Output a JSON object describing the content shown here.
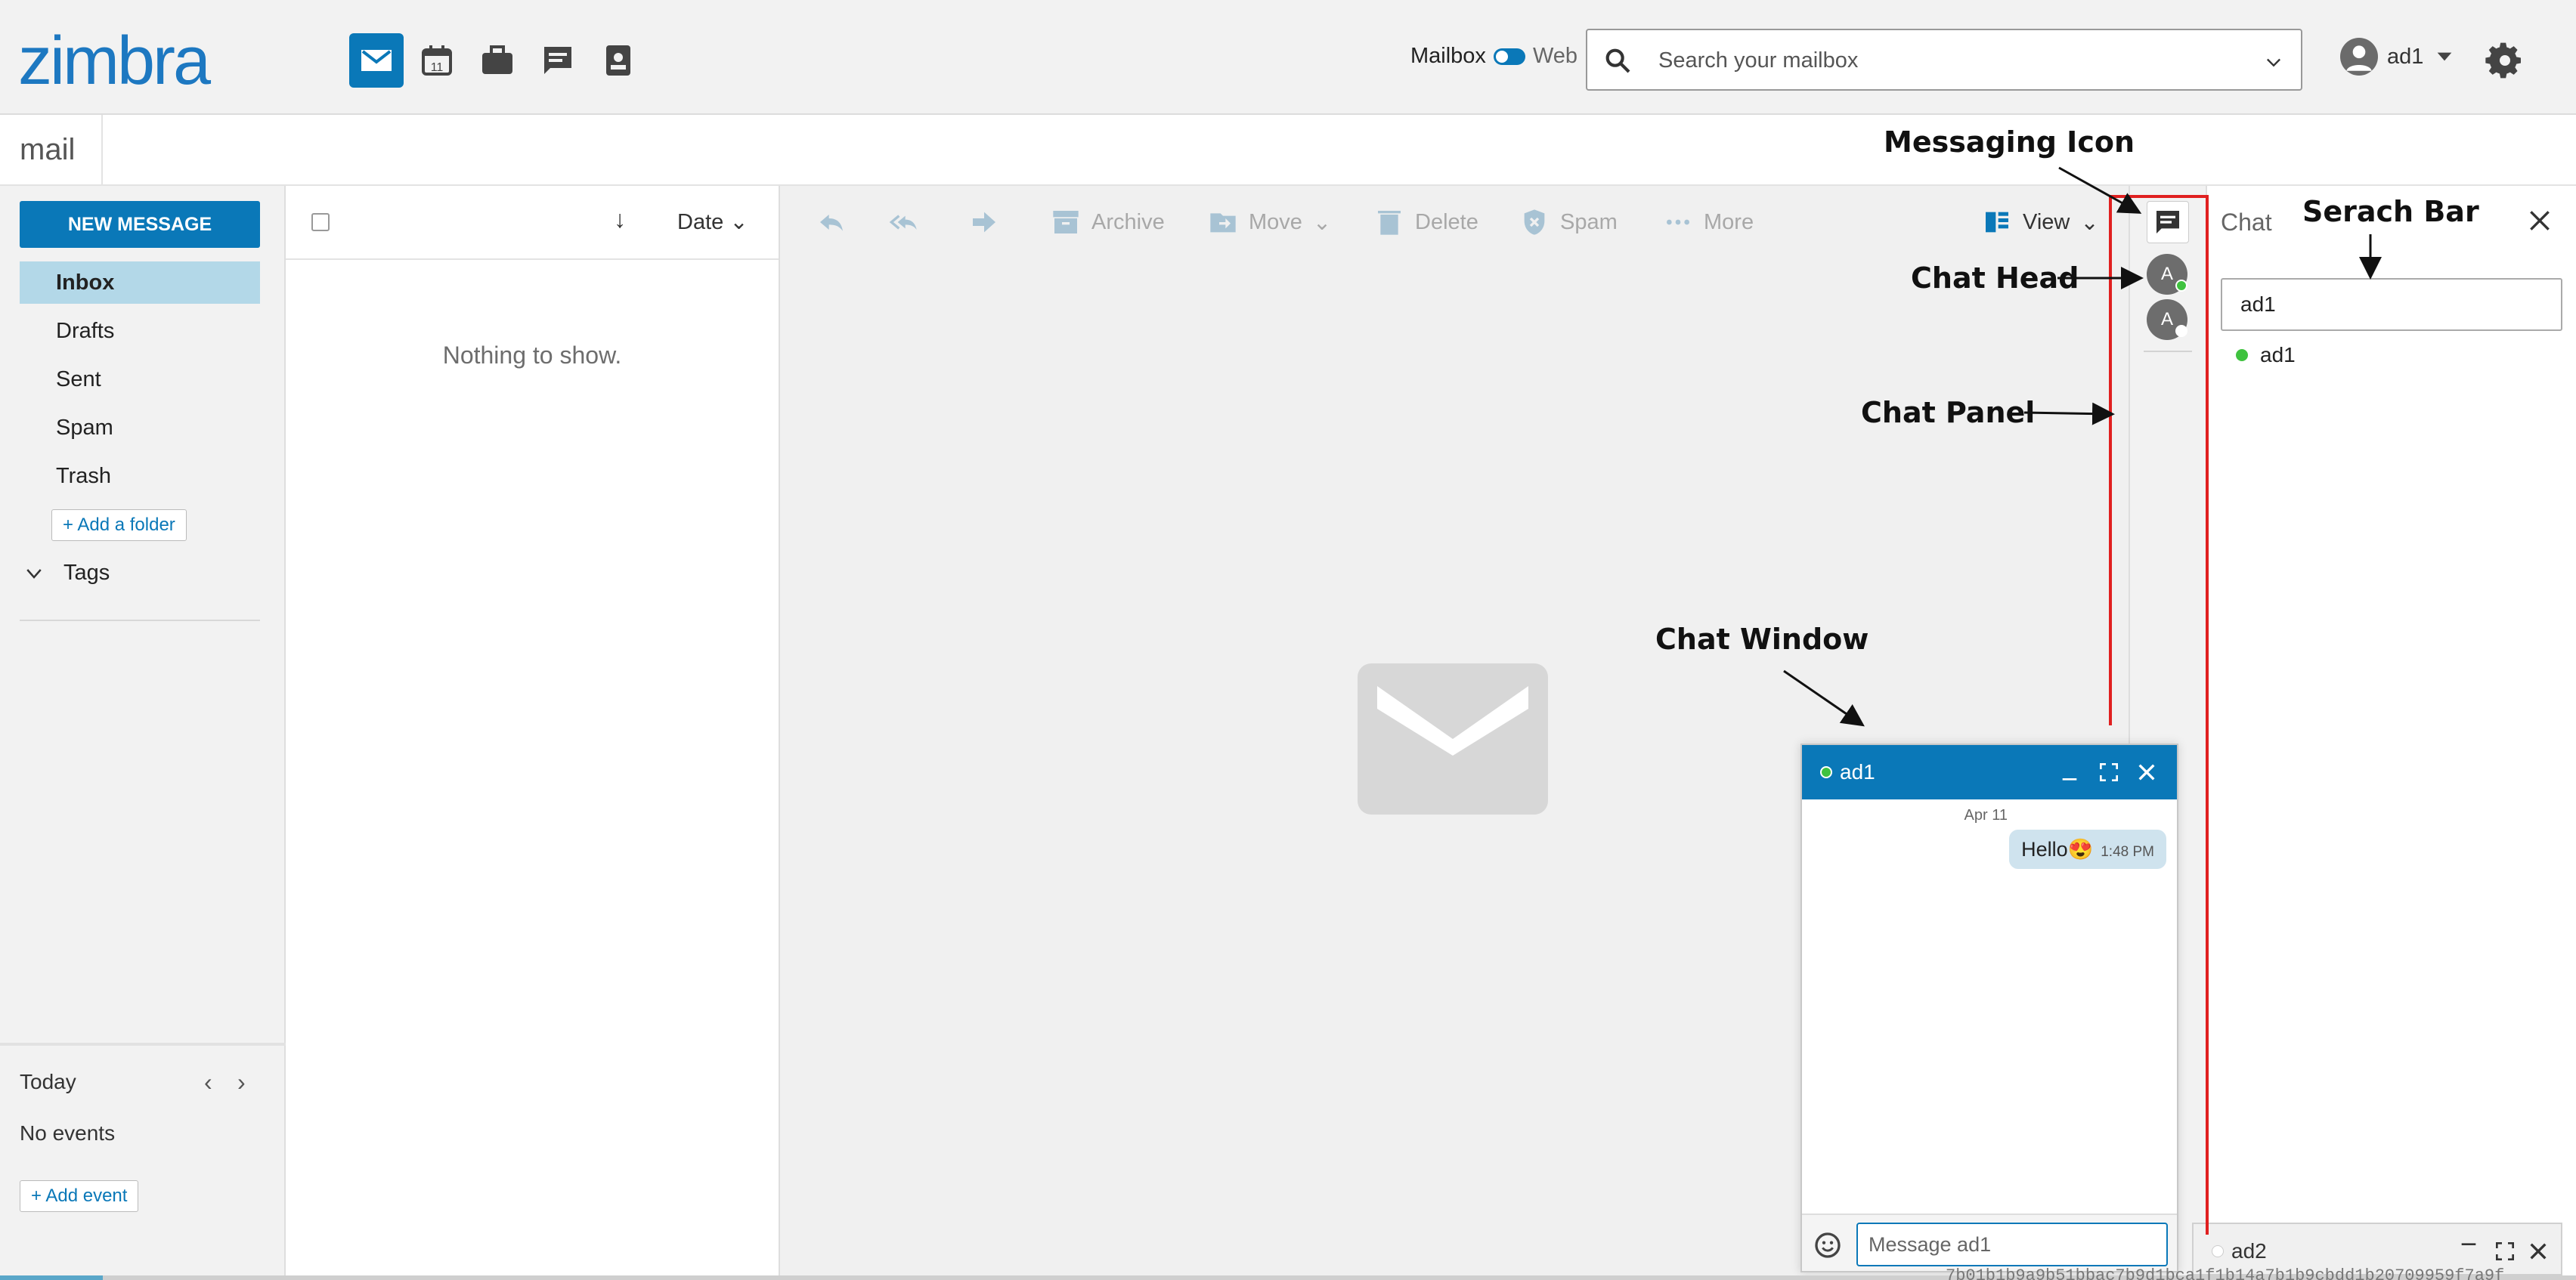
{
  "header": {
    "logo": "zimbra",
    "apps": [
      "mail-icon",
      "calendar-icon",
      "briefcase-icon",
      "chat-icon",
      "contacts-icon"
    ],
    "calendar_day": "11",
    "mode_mailbox": "Mailbox",
    "mode_web": "Web",
    "search_placeholder": "Search your mailbox",
    "user": "ad1"
  },
  "subheader": {
    "app_label": "mail"
  },
  "sidebar": {
    "new_message": "NEW MESSAGE",
    "folders": [
      "Inbox",
      "Drafts",
      "Sent",
      "Spam",
      "Trash"
    ],
    "selected_folder": "Inbox",
    "add_folder": "+ Add a folder",
    "tags": "Tags",
    "today": "Today",
    "no_events": "No events",
    "add_event": "+ Add event"
  },
  "list": {
    "sort_label": "Date",
    "empty": "Nothing to show."
  },
  "toolbar": {
    "archive": "Archive",
    "move": "Move",
    "delete": "Delete",
    "spam": "Spam",
    "more": "More",
    "view": "View"
  },
  "chat_strip": {
    "heads": [
      {
        "initial": "A",
        "status_color": "#3fc23f"
      },
      {
        "initial": "A",
        "status_color": "#ffffff"
      }
    ]
  },
  "chat_panel": {
    "title": "Chat",
    "search_value": "ad1",
    "contacts": [
      {
        "name": "ad1",
        "status_color": "#3fc23f"
      }
    ]
  },
  "chat_window": {
    "contact": "ad1",
    "status_color": "#3fc23f",
    "date": "Apr 11",
    "message_text": "Hello😍",
    "message_time": "1:48 PM",
    "input_placeholder": "Message ad1"
  },
  "chat_minimized": {
    "contact": "ad2",
    "status_color": "#ffffff"
  },
  "footer": {
    "hash": "7b01b1b9a9b51bbac7b9d1bca1f1b14a7b1b9cbdd1b20709959f7a9f"
  },
  "annotations": {
    "messaging_icon": "Messaging Icon",
    "search_bar": "Serach Bar",
    "chat_head": "Chat Head",
    "chat_panel": "Chat Panel",
    "chat_window": "Chat Window"
  },
  "colors": {
    "brand": "#0a78b8",
    "selected": "#b3d8e8",
    "highlight": "#e02020"
  }
}
